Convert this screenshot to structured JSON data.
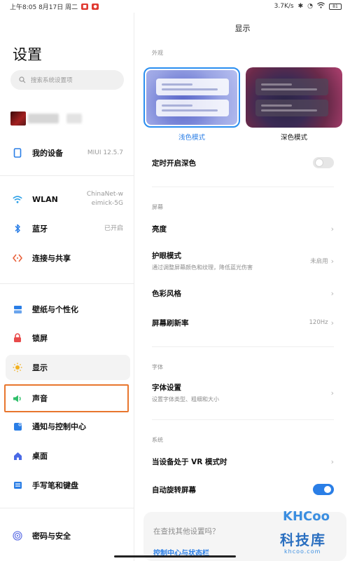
{
  "status_bar": {
    "time_date": "上午8:05  8月17日 周二",
    "net_speed": "3.7K/s",
    "battery": "81"
  },
  "left": {
    "title": "设置",
    "search_placeholder": "搜索系统设置项",
    "items": [
      {
        "id": "my-device",
        "label": "我的设备",
        "value": "MIUI 12.5.7",
        "icon": "tablet-icon",
        "color": "#2a7ee6"
      },
      {
        "id": "wlan",
        "label": "WLAN",
        "value_line1": "ChinaNet-w",
        "value_line2": "eimick-5G",
        "icon": "wifi-icon",
        "color": "#2a9ee6"
      },
      {
        "id": "bluetooth",
        "label": "蓝牙",
        "value": "已开启",
        "icon": "bluetooth-icon",
        "color": "#2a7ee6"
      },
      {
        "id": "connection-share",
        "label": "连接与共享",
        "icon": "share-icon",
        "color": "#e8603a"
      },
      {
        "id": "wallpaper",
        "label": "壁纸与个性化",
        "icon": "wallpaper-icon",
        "color": "#2a7ee6"
      },
      {
        "id": "lockscreen",
        "label": "锁屏",
        "icon": "lock-icon",
        "color": "#e84a4a"
      },
      {
        "id": "display",
        "label": "显示",
        "icon": "sun-icon",
        "color": "#f2b01e"
      },
      {
        "id": "sound",
        "label": "声音",
        "icon": "speaker-icon",
        "color": "#2fbf6a"
      },
      {
        "id": "notification",
        "label": "通知与控制中心",
        "icon": "notification-icon",
        "color": "#2a7ee6"
      },
      {
        "id": "desktop",
        "label": "桌面",
        "icon": "home-icon",
        "color": "#4a6ae6"
      },
      {
        "id": "pen-keyboard",
        "label": "手写笔和键盘",
        "icon": "keyboard-icon",
        "color": "#2a7ee6"
      },
      {
        "id": "password-security",
        "label": "密码与安全",
        "icon": "fingerprint-icon",
        "color": "#6a7ae6"
      }
    ]
  },
  "right": {
    "title": "显示",
    "section_appearance": "外观",
    "theme_light": "浅色模式",
    "theme_dark": "深色模式",
    "scheduled_dark": "定时开启深色",
    "section_screen": "屏幕",
    "brightness": "亮度",
    "eye_care_title": "护眼模式",
    "eye_care_sub": "通过调整屏幕颜色和纹理，降低蓝光伤害",
    "eye_care_value": "未启用",
    "color_style": "色彩风格",
    "refresh_rate": "屏幕刷新率",
    "refresh_rate_value": "120Hz",
    "section_font": "字体",
    "font_settings_title": "字体设置",
    "font_settings_sub": "设置字体类型、粗细和大小",
    "section_system": "系统",
    "vr_mode": "当设备处于 VR 模式时",
    "auto_rotate": "自动旋转屏幕",
    "search_more_title": "在查找其他设置吗？",
    "search_more_link": "控制中心与状态栏"
  },
  "toggles": {
    "scheduled_dark": "off",
    "auto_rotate": "on"
  },
  "watermark": {
    "brand": "KHCoo",
    "cn": "科技库",
    "url": "khcoo.com"
  }
}
